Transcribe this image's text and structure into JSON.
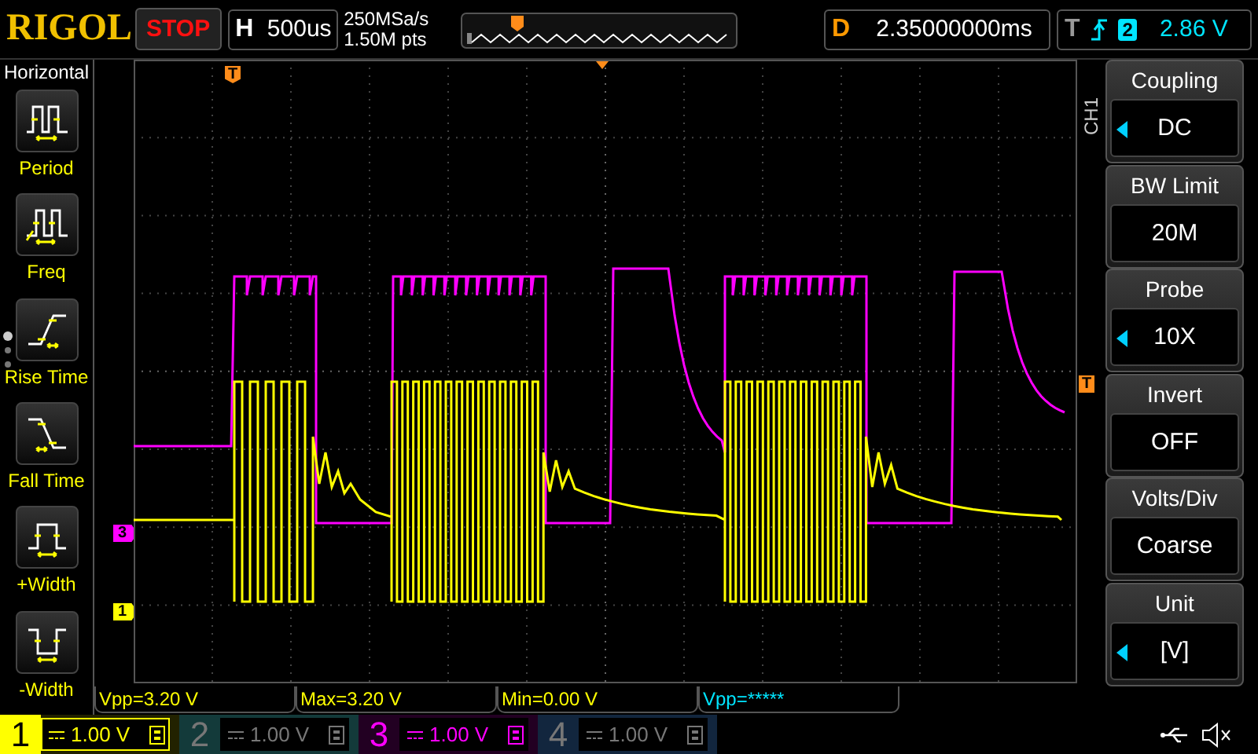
{
  "top_bar": {
    "logo": "RIGOL",
    "run_status": "STOP",
    "horizontal": {
      "label": "H",
      "timebase": "500us"
    },
    "sample_rate": "250MSa/s",
    "memory_depth": "1.50M pts",
    "delay": {
      "label": "D",
      "value": "2.35000000ms"
    },
    "trigger": {
      "label": "T",
      "source": "2",
      "level": "2.86 V"
    }
  },
  "left_menu": {
    "title": "Horizontal",
    "items": [
      {
        "kind": "period",
        "label": "Period"
      },
      {
        "kind": "freq",
        "label": "Freq"
      },
      {
        "kind": "rise",
        "label": "Rise Time"
      },
      {
        "kind": "fall",
        "label": "Fall Time"
      },
      {
        "kind": "pwidth",
        "label": "+Width"
      },
      {
        "kind": "nwidth",
        "label": "-Width"
      }
    ]
  },
  "trace_markers": [
    {
      "label": "T",
      "kind": "trigger-time"
    },
    {
      "label": "3",
      "kind": "channel",
      "color": "#ff00ff"
    },
    {
      "label": "1",
      "kind": "channel",
      "color": "#ffff00"
    },
    {
      "label": "T",
      "kind": "trigger-level"
    }
  ],
  "channel_label": "CH1",
  "right_menu": [
    {
      "title": "Coupling",
      "value": "DC",
      "adjustable": true
    },
    {
      "title": "BW Limit",
      "value": "20M",
      "adjustable": false
    },
    {
      "title": "Probe",
      "value": "10X",
      "adjustable": true
    },
    {
      "title": "Invert",
      "value": "OFF",
      "adjustable": false
    },
    {
      "title": "Volts/Div",
      "value": "Coarse",
      "adjustable": false
    },
    {
      "title": "Unit",
      "value": "[V]",
      "adjustable": true
    }
  ],
  "measurements": [
    {
      "text": "Vpp=3.20 V",
      "color": "#ffff00"
    },
    {
      "text": "Max=3.20 V",
      "color": "#ffff00"
    },
    {
      "text": "Min=0.00 V",
      "color": "#ffff00"
    },
    {
      "text": "Vpp=*****",
      "color": "#00e5ff"
    }
  ],
  "channels": [
    {
      "number": "1",
      "scale": "1.00 V",
      "enabled": true,
      "selected": true,
      "color": "#ffff00"
    },
    {
      "number": "2",
      "scale": "1.00 V",
      "enabled": false,
      "selected": false,
      "color": "#133a3a"
    },
    {
      "number": "3",
      "scale": "1.00 V",
      "enabled": true,
      "selected": false,
      "color": "#ff00ff"
    },
    {
      "number": "4",
      "scale": "1.00 V",
      "enabled": false,
      "selected": false,
      "color": "#12263e"
    }
  ]
}
